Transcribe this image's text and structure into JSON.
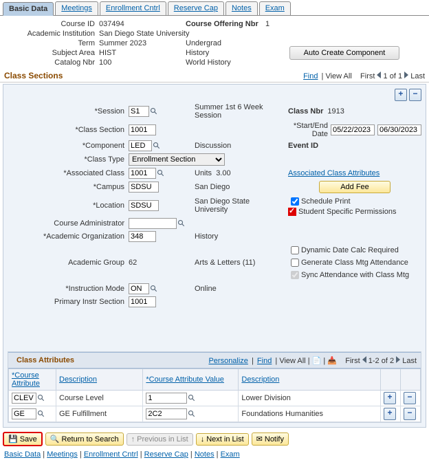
{
  "tabs": {
    "t0": "Basic Data",
    "t1": "Meetings",
    "t2": "Enrollment Cntrl",
    "t3": "Reserve Cap",
    "t4": "Notes",
    "t5": "Exam"
  },
  "hdr": {
    "courseIdLbl": "Course ID",
    "courseId": "037494",
    "offerLbl": "Course Offering Nbr",
    "offer": "1",
    "instLbl": "Academic Institution",
    "inst": "San Diego State University",
    "termLbl": "Term",
    "term": "Summer 2023",
    "careerVal": "Undergrad",
    "subjLbl": "Subject Area",
    "subj": "HIST",
    "subjDesc": "History",
    "catLbl": "Catalog Nbr",
    "cat": "100",
    "catDesc": "World History",
    "autoBtn": "Auto Create Component"
  },
  "sect": {
    "title": "Class Sections",
    "find": "Find",
    "viewAll": "View All",
    "first": "First",
    "count": "1 of 1",
    "last": "Last"
  },
  "form": {
    "sessionLbl": "*Session",
    "session": "S1",
    "sessionDesc": "Summer 1st 6 Week Session",
    "classNbrLbl": "Class Nbr",
    "classNbr": "1913",
    "csLbl": "*Class Section",
    "cs": "1001",
    "dateLbl": "*Start/End Date",
    "d1": "05/22/2023",
    "d2": "06/30/2023",
    "compLbl": "*Component",
    "comp": "LED",
    "compDesc": "Discussion",
    "eventLbl": "Event ID",
    "ctypeLbl": "*Class Type",
    "ctype": "Enrollment Section",
    "assocLbl": "*Associated Class",
    "assoc": "1001",
    "unitsLbl": "Units",
    "units": "3.00",
    "aclLbl": "Associated Class Attributes",
    "campusLbl": "*Campus",
    "campus": "SDSU",
    "campusDesc": "San Diego",
    "addFee": "Add Fee",
    "locLbl": "*Location",
    "loc": "SDSU",
    "locDesc": "San Diego State University",
    "sp": "Schedule Print",
    "ssp": "Student Specific Permissions",
    "adminLbl": "Course Administrator",
    "admin": "",
    "aorgLbl": "*Academic Organization",
    "aorg": "348",
    "aorgDesc": "History",
    "agrpLbl": "Academic Group",
    "agrp": "62",
    "agrpDesc": "Arts & Letters (11)",
    "ddc": "Dynamic Date Calc Required",
    "gcma": "Generate Class Mtg Attendance",
    "sac": "Sync Attendance with Class Mtg",
    "imodeLbl": "*Instruction Mode",
    "imode": "ON",
    "imodeDesc": "Online",
    "pisLbl": "Primary Instr Section",
    "pis": "1001"
  },
  "attr": {
    "title": "Class Attributes",
    "personalize": "Personalize",
    "find": "Find",
    "viewAll": "View All",
    "first": "First",
    "count": "1-2 of 2",
    "last": "Last",
    "h1": "*Course Attribute",
    "h2": "Description",
    "h3": "*Course Attribute Value",
    "h4": "Description",
    "rows": [
      {
        "a": "CLEV",
        "b": "Course Level",
        "c": "1",
        "d": "Lower Division"
      },
      {
        "a": "GE",
        "b": "GE Fulfillment",
        "c": "2C2",
        "d": "Foundations Humanities"
      }
    ]
  },
  "btns": {
    "save": "Save",
    "ret": "Return to Search",
    "prev": "Previous in List",
    "next": "Next in List",
    "notify": "Notify"
  },
  "foot": {
    "t0": "Basic Data",
    "t1": "Meetings",
    "t2": "Enrollment Cntrl",
    "t3": "Reserve Cap",
    "t4": "Notes",
    "t5": "Exam"
  }
}
